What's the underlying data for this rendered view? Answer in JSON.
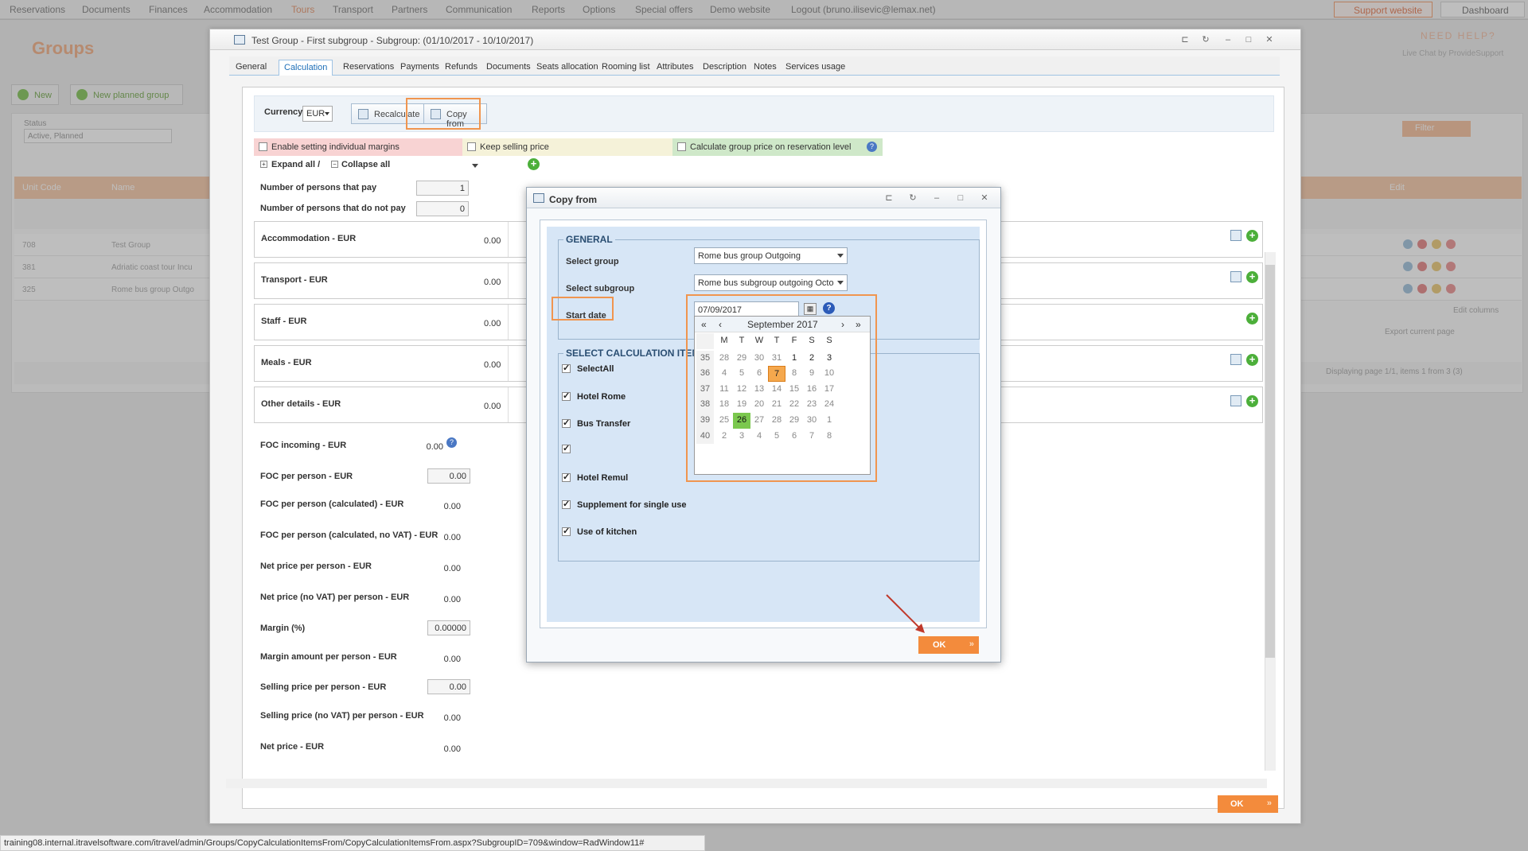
{
  "topnav": {
    "items": [
      "Reservations",
      "Documents",
      "Finances",
      "Accommodation",
      "Tours",
      "Transport",
      "Partners",
      "Communication",
      "Reports",
      "Options",
      "Special offers",
      "Demo website",
      "Logout (bruno.ilisevic@lemax.net)"
    ],
    "support": "Support website",
    "dashboard": "Dashboard"
  },
  "background": {
    "title": "Groups",
    "need_help": "NEED HELP?",
    "live_chat": "Live Chat by ProvideSupport",
    "new_btn": "New",
    "new_planned_btn": "New planned group",
    "status_label": "Status",
    "status_value": "Active, Planned",
    "filter_btn": "Filter",
    "grid_headers": [
      "Unit Code",
      "Name",
      "Edit"
    ],
    "rows": [
      {
        "code": "708",
        "name": "Test Group"
      },
      {
        "code": "381",
        "name": "Adriatic coast tour Incu"
      },
      {
        "code": "325",
        "name": "Rome bus group Outgo"
      }
    ],
    "edit_columns": "Edit columns",
    "export_page": "Export current page",
    "pager_info": "Displaying page 1/1, items 1 from 3 (3)",
    "status_url": "training08.internal.itravelsoftware.com/itravel/admin/Groups/CopyCalculationItemsFrom/CopyCalculationItemsFrom.aspx?SubgroupID=709&window=RadWindow11#"
  },
  "main_window": {
    "title": "Test Group - First subgroup - Subgroup: (01/10/2017 - 10/10/2017)",
    "tabs": [
      "General",
      "Calculation",
      "Reservations",
      "Payments",
      "Refunds",
      "Documents",
      "Seats allocation",
      "Rooming list",
      "Attributes",
      "Description",
      "Notes",
      "Services usage"
    ],
    "active_tab": "Calculation",
    "currency_label": "Currency:",
    "currency_value": "EUR",
    "recalculate": "Recalculate",
    "copy_from": "Copy from",
    "enable_margins": "Enable setting individual margins",
    "keep_selling": "Keep selling price",
    "calc_group_price": "Calculate group price on reservation level",
    "expand_all": "Expand all /",
    "collapse_all": "Collapse all",
    "persons_pay_label": "Number of persons that pay",
    "persons_pay_value": "1",
    "persons_not_pay_label": "Number of persons that do not pay",
    "persons_not_pay_value": "0",
    "sections": [
      {
        "name": "Accommodation - EUR",
        "value": "0.00"
      },
      {
        "name": "Transport - EUR",
        "value": "0.00"
      },
      {
        "name": "Staff - EUR",
        "value": "0.00"
      },
      {
        "name": "Meals - EUR",
        "value": "0.00"
      },
      {
        "name": "Other details - EUR",
        "value": "0.00"
      }
    ],
    "details": [
      {
        "label": "FOC incoming - EUR",
        "value": "0.00"
      },
      {
        "label": "FOC per person - EUR",
        "value": "0.00"
      },
      {
        "label": "FOC per person (calculated) - EUR",
        "value": "0.00"
      },
      {
        "label": "FOC per person (calculated, no VAT) - EUR",
        "value": "0.00"
      },
      {
        "label": "Net price per person - EUR",
        "value": "0.00"
      },
      {
        "label": "Net price (no VAT) per person - EUR",
        "value": "0.00"
      },
      {
        "label": "Margin (%)",
        "value": "0.00000"
      },
      {
        "label": "Margin amount per person - EUR",
        "value": "0.00"
      },
      {
        "label": "Selling price per person - EUR",
        "value": "0.00"
      },
      {
        "label": "Selling price (no VAT) per person - EUR",
        "value": "0.00"
      },
      {
        "label": "Net price - EUR",
        "value": "0.00"
      }
    ],
    "ok": "OK"
  },
  "dialog": {
    "title": "Copy from",
    "general_legend": "GENERAL",
    "select_group_label": "Select group",
    "select_group_value": "Rome bus group Outgoing",
    "select_subgroup_label": "Select subgroup",
    "select_subgroup_value": "Rome bus subgroup outgoing Octo",
    "start_date_label": "Start date",
    "start_date_value": "07/09/2017",
    "items_legend": "SELECT CALCULATION ITEM",
    "items": [
      "SelectAll",
      "Hotel Rome",
      "Bus Transfer",
      "",
      "Hotel Remul",
      "Supplement for single use",
      "Use of kitchen"
    ],
    "ok": "OK"
  },
  "calendar": {
    "month": "September 2017",
    "day_headers": [
      "M",
      "T",
      "W",
      "T",
      "F",
      "S",
      "S"
    ],
    "weeks": [
      {
        "wk": "35",
        "days": [
          "28",
          "29",
          "30",
          "31",
          "1",
          "2",
          "3"
        ]
      },
      {
        "wk": "36",
        "days": [
          "4",
          "5",
          "6",
          "7",
          "8",
          "9",
          "10"
        ]
      },
      {
        "wk": "37",
        "days": [
          "11",
          "12",
          "13",
          "14",
          "15",
          "16",
          "17"
        ]
      },
      {
        "wk": "38",
        "days": [
          "18",
          "19",
          "20",
          "21",
          "22",
          "23",
          "24"
        ]
      },
      {
        "wk": "39",
        "days": [
          "25",
          "26",
          "27",
          "28",
          "29",
          "30",
          "1"
        ]
      },
      {
        "wk": "40",
        "days": [
          "2",
          "3",
          "4",
          "5",
          "6",
          "7",
          "8"
        ]
      }
    ],
    "selected_day": "7",
    "today_day": "26"
  },
  "colors": {
    "accent": "#f38b3c",
    "highlight": "#f0954f",
    "today": "#7bc84e",
    "dialog_bg": "#d7e6f6"
  }
}
